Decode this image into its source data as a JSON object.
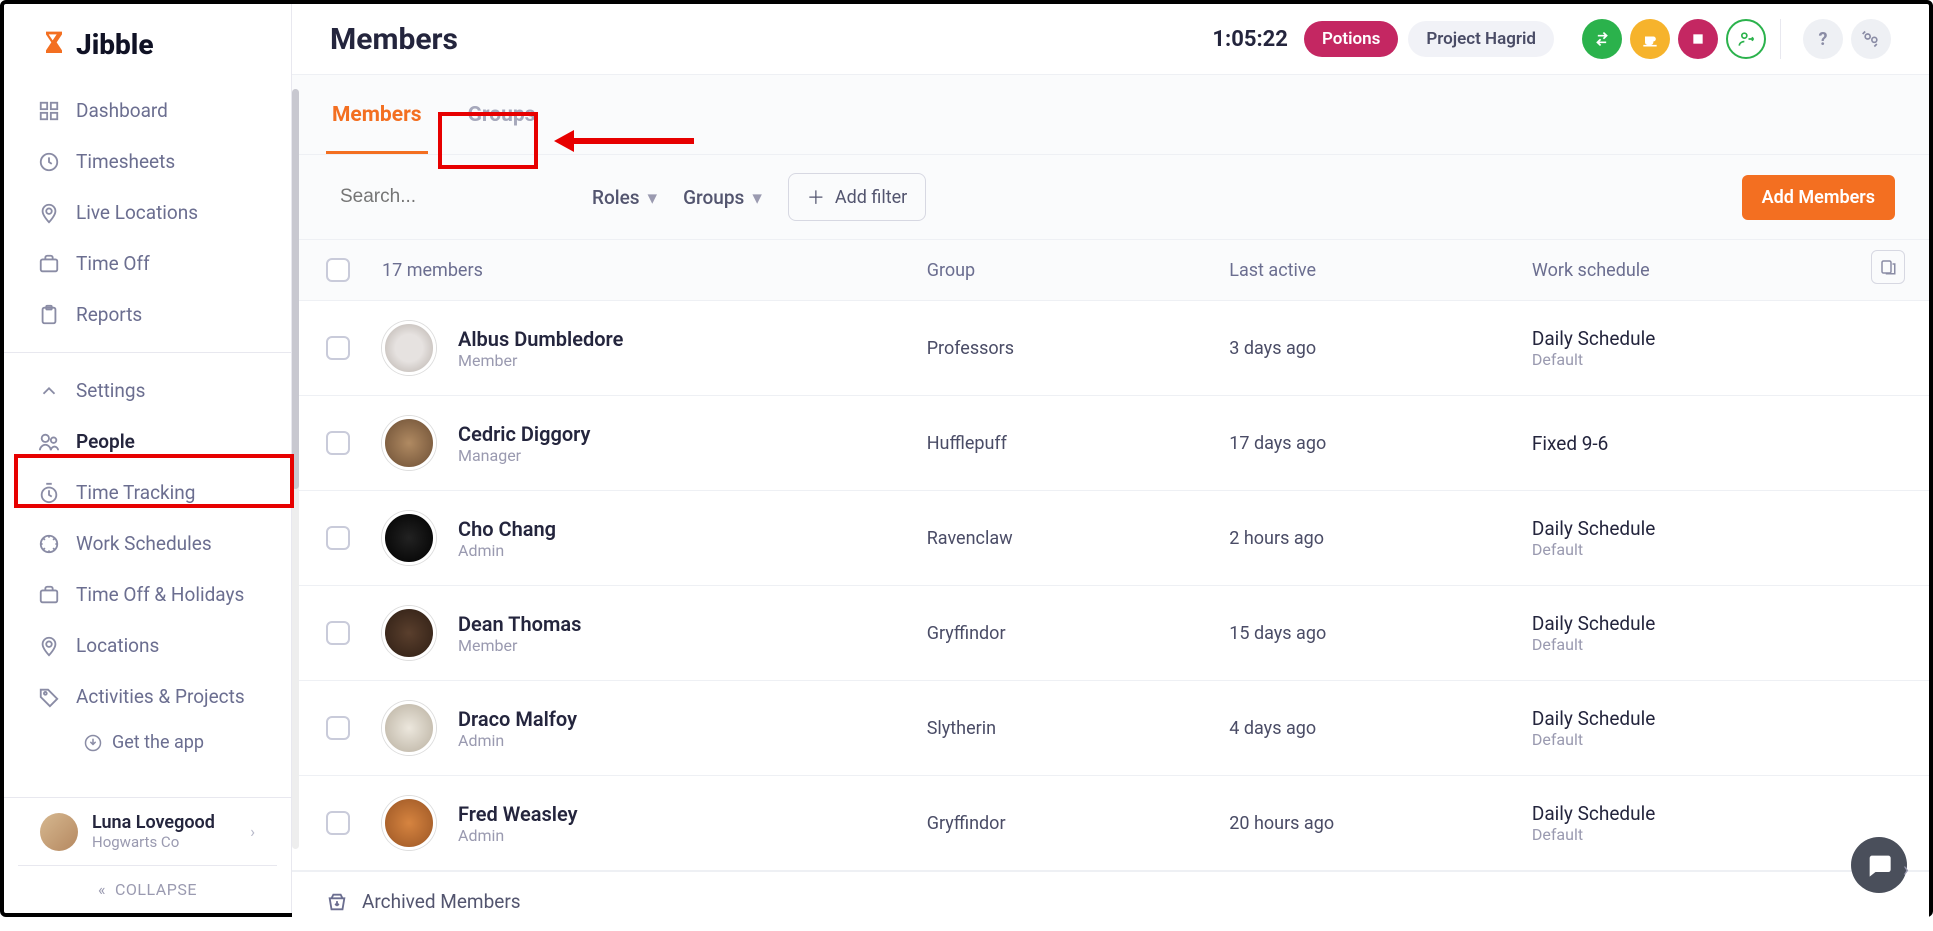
{
  "logo": "Jibble",
  "sidebar": {
    "section1": [
      {
        "label": "Dashboard",
        "icon": "dashboard"
      },
      {
        "label": "Timesheets",
        "icon": "clock"
      },
      {
        "label": "Live Locations",
        "icon": "pin"
      },
      {
        "label": "Time Off",
        "icon": "briefcase"
      },
      {
        "label": "Reports",
        "icon": "clipboard"
      }
    ],
    "section2": [
      {
        "label": "Settings",
        "icon": "caret-up"
      },
      {
        "label": "People",
        "icon": "people",
        "active": true
      },
      {
        "label": "Time Tracking",
        "icon": "timer"
      },
      {
        "label": "Work Schedules",
        "icon": "schedule"
      },
      {
        "label": "Time Off & Holidays",
        "icon": "briefcase"
      },
      {
        "label": "Locations",
        "icon": "pin"
      },
      {
        "label": "Activities & Projects",
        "icon": "tag"
      }
    ],
    "get_app": "Get the app",
    "collapse": "COLLAPSE"
  },
  "user": {
    "name": "Luna Lovegood",
    "org": "Hogwarts Co"
  },
  "header": {
    "title": "Members",
    "timer": "1:05:22",
    "pill1": "Potions",
    "pill2": "Project Hagrid"
  },
  "tabs": {
    "members": "Members",
    "groups": "Groups"
  },
  "filters": {
    "search_placeholder": "Search...",
    "roles": "Roles",
    "groups": "Groups",
    "add_filter": "Add filter",
    "add_members": "Add Members"
  },
  "table": {
    "count_label": "17 members",
    "col_group": "Group",
    "col_last": "Last active",
    "col_sched": "Work schedule",
    "rows": [
      {
        "name": "Albus Dumbledore",
        "role": "Member",
        "group": "Professors",
        "last": "3 days ago",
        "sched": "Daily Schedule",
        "sched_sub": "Default",
        "av": "av1"
      },
      {
        "name": "Cedric Diggory",
        "role": "Manager",
        "group": "Hufflepuff",
        "last": "17 days ago",
        "sched": "Fixed 9-6",
        "sched_sub": "",
        "av": "av2"
      },
      {
        "name": "Cho Chang",
        "role": "Admin",
        "group": "Ravenclaw",
        "last": "2 hours ago",
        "sched": "Daily Schedule",
        "sched_sub": "Default",
        "av": "av3"
      },
      {
        "name": "Dean Thomas",
        "role": "Member",
        "group": "Gryffindor",
        "last": "15 days ago",
        "sched": "Daily Schedule",
        "sched_sub": "Default",
        "av": "av4"
      },
      {
        "name": "Draco Malfoy",
        "role": "Admin",
        "group": "Slytherin",
        "last": "4 days ago",
        "sched": "Daily Schedule",
        "sched_sub": "Default",
        "av": "av5"
      },
      {
        "name": "Fred Weasley",
        "role": "Admin",
        "group": "Gryffindor",
        "last": "20 hours ago",
        "sched": "Daily Schedule",
        "sched_sub": "Default",
        "av": "av6"
      }
    ],
    "archived": "Archived Members"
  }
}
